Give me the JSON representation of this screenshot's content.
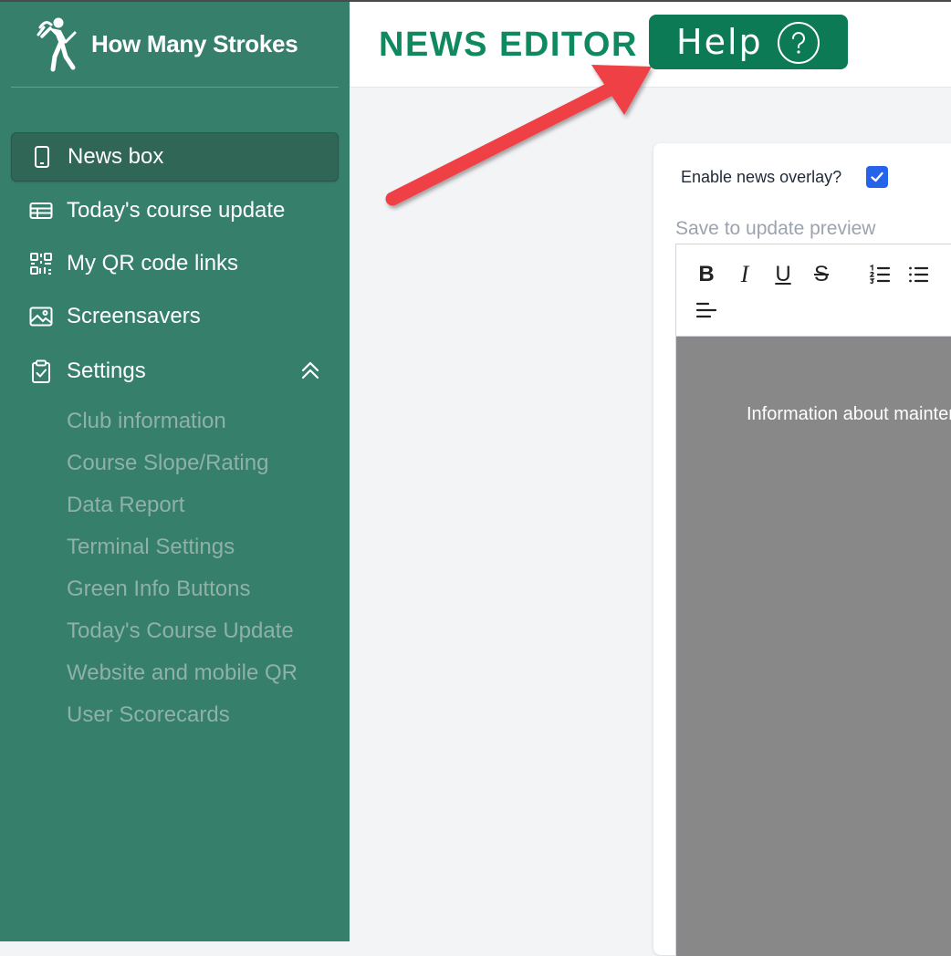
{
  "app": {
    "name": "How Many Strokes"
  },
  "sidebar": {
    "items": [
      {
        "label": "News box",
        "icon": "tablet-icon",
        "active": true
      },
      {
        "label": "Today's course update",
        "icon": "table-icon",
        "active": false
      },
      {
        "label": "My QR code links",
        "icon": "qr-code-icon",
        "active": false
      },
      {
        "label": "Screensavers",
        "icon": "image-icon",
        "active": false
      },
      {
        "label": "Settings",
        "icon": "clipboard-check-icon",
        "active": false,
        "expanded": true
      }
    ],
    "settings_subitems": [
      "Club information",
      "Course Slope/Rating",
      "Data Report",
      "Terminal Settings",
      "Green Info Buttons",
      "Today's Course Update",
      "Website and mobile QR",
      "User Scorecards"
    ]
  },
  "header": {
    "title": "NEWS EDITOR",
    "help_label": "Help",
    "help_icon": "question-circle-icon"
  },
  "editor": {
    "overlay_label": "Enable news overlay?",
    "overlay_checked": true,
    "save_hint": "Save to update preview",
    "toolbar": {
      "bold": "B",
      "italic": "I",
      "underline": "U",
      "strike": "S"
    },
    "content_text": "Information about mainten"
  },
  "colors": {
    "sidebar_bg": "#367f6b",
    "accent_green": "#0b7a55",
    "title_green": "#0f8a5f",
    "annotation_arrow": "#ee3f45",
    "checkbox_blue": "#2563eb",
    "preview_gray": "#888888"
  }
}
